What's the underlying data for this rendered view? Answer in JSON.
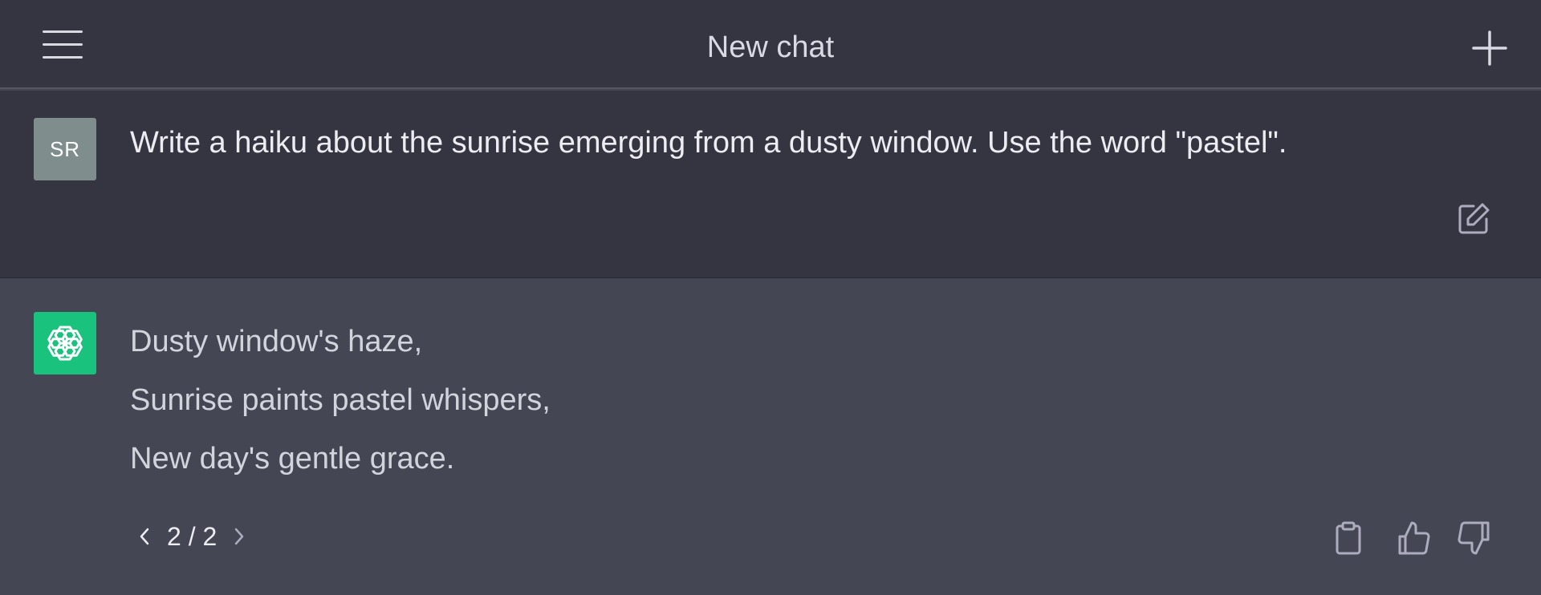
{
  "header": {
    "title": "New chat",
    "menu_icon": "hamburger-menu-icon",
    "new_chat_icon": "plus-icon"
  },
  "user_message": {
    "avatar_initials": "SR",
    "avatar_color": "#7f8d8c",
    "text": "Write a haiku about the sunrise emerging from a dusty window. Use the word \"pastel\".",
    "edit_icon": "edit-icon"
  },
  "assistant_message": {
    "avatar_icon": "openai-logo-icon",
    "avatar_color": "#19c37d",
    "lines": [
      "Dusty window's haze,",
      "Sunrise paints pastel whispers,",
      "New day's gentle grace."
    ],
    "pager": {
      "prev_icon": "chevron-left-icon",
      "current": "2",
      "separator": "/",
      "total": "2",
      "label": "2 / 2",
      "next_icon": "chevron-right-icon"
    },
    "actions": {
      "copy_icon": "clipboard-icon",
      "thumbs_up_icon": "thumbs-up-icon",
      "thumbs_down_icon": "thumbs-down-icon"
    }
  },
  "colors": {
    "header_bg": "#343541",
    "assistant_bg": "#444654",
    "text_primary": "#ececf1"
  }
}
